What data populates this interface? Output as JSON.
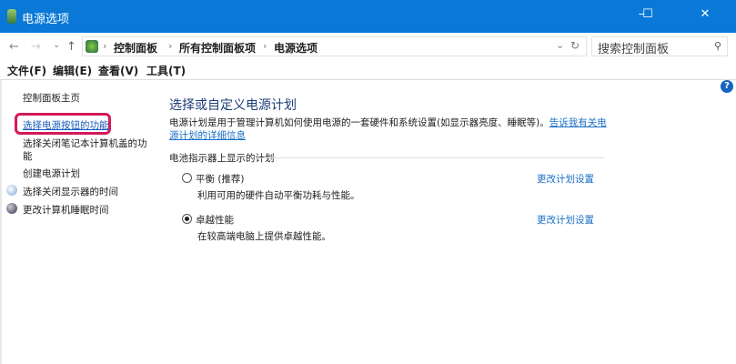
{
  "window": {
    "title": "电源选项",
    "minimize": "–",
    "maximize": "☐",
    "close": "✕"
  },
  "address": {
    "back": "←",
    "forward": "→",
    "recent": "⌄",
    "up": "↑",
    "crumbs": [
      "控制面板",
      "所有控制面板项",
      "电源选项"
    ],
    "separator": "›",
    "dropdown": "⌄",
    "refresh": "↻",
    "search_placeholder": "搜索控制面板",
    "search_icon": "⚲"
  },
  "menu": [
    "文件(F)",
    "编辑(E)",
    "查看(V)",
    "工具(T)"
  ],
  "sidebar": {
    "home": "控制面板主页",
    "items": [
      "选择电源按钮的功能",
      "选择关闭笔记本计算机盖的功",
      "能",
      "创建电源计划",
      "选择关闭显示器的时间",
      "更改计算机睡眠时间"
    ]
  },
  "main": {
    "title": "选择或自定义电源计划",
    "description": "电源计划是用于管理计算机如何使用电源的一套硬件和系统设置(如显示器亮度、睡眠等)。",
    "learn_more": "告诉我有关电源计划的详细信息",
    "group_label": "电池指示器上显示的计划",
    "plans": [
      {
        "name": "平衡 (推荐)",
        "desc": "利用可用的硬件自动平衡功耗与性能。",
        "selected": false,
        "link": "更改计划设置"
      },
      {
        "name": "卓越性能",
        "desc": "在较高端电脑上提供卓越性能。",
        "selected": true,
        "link": "更改计划设置"
      }
    ],
    "help": "?"
  }
}
